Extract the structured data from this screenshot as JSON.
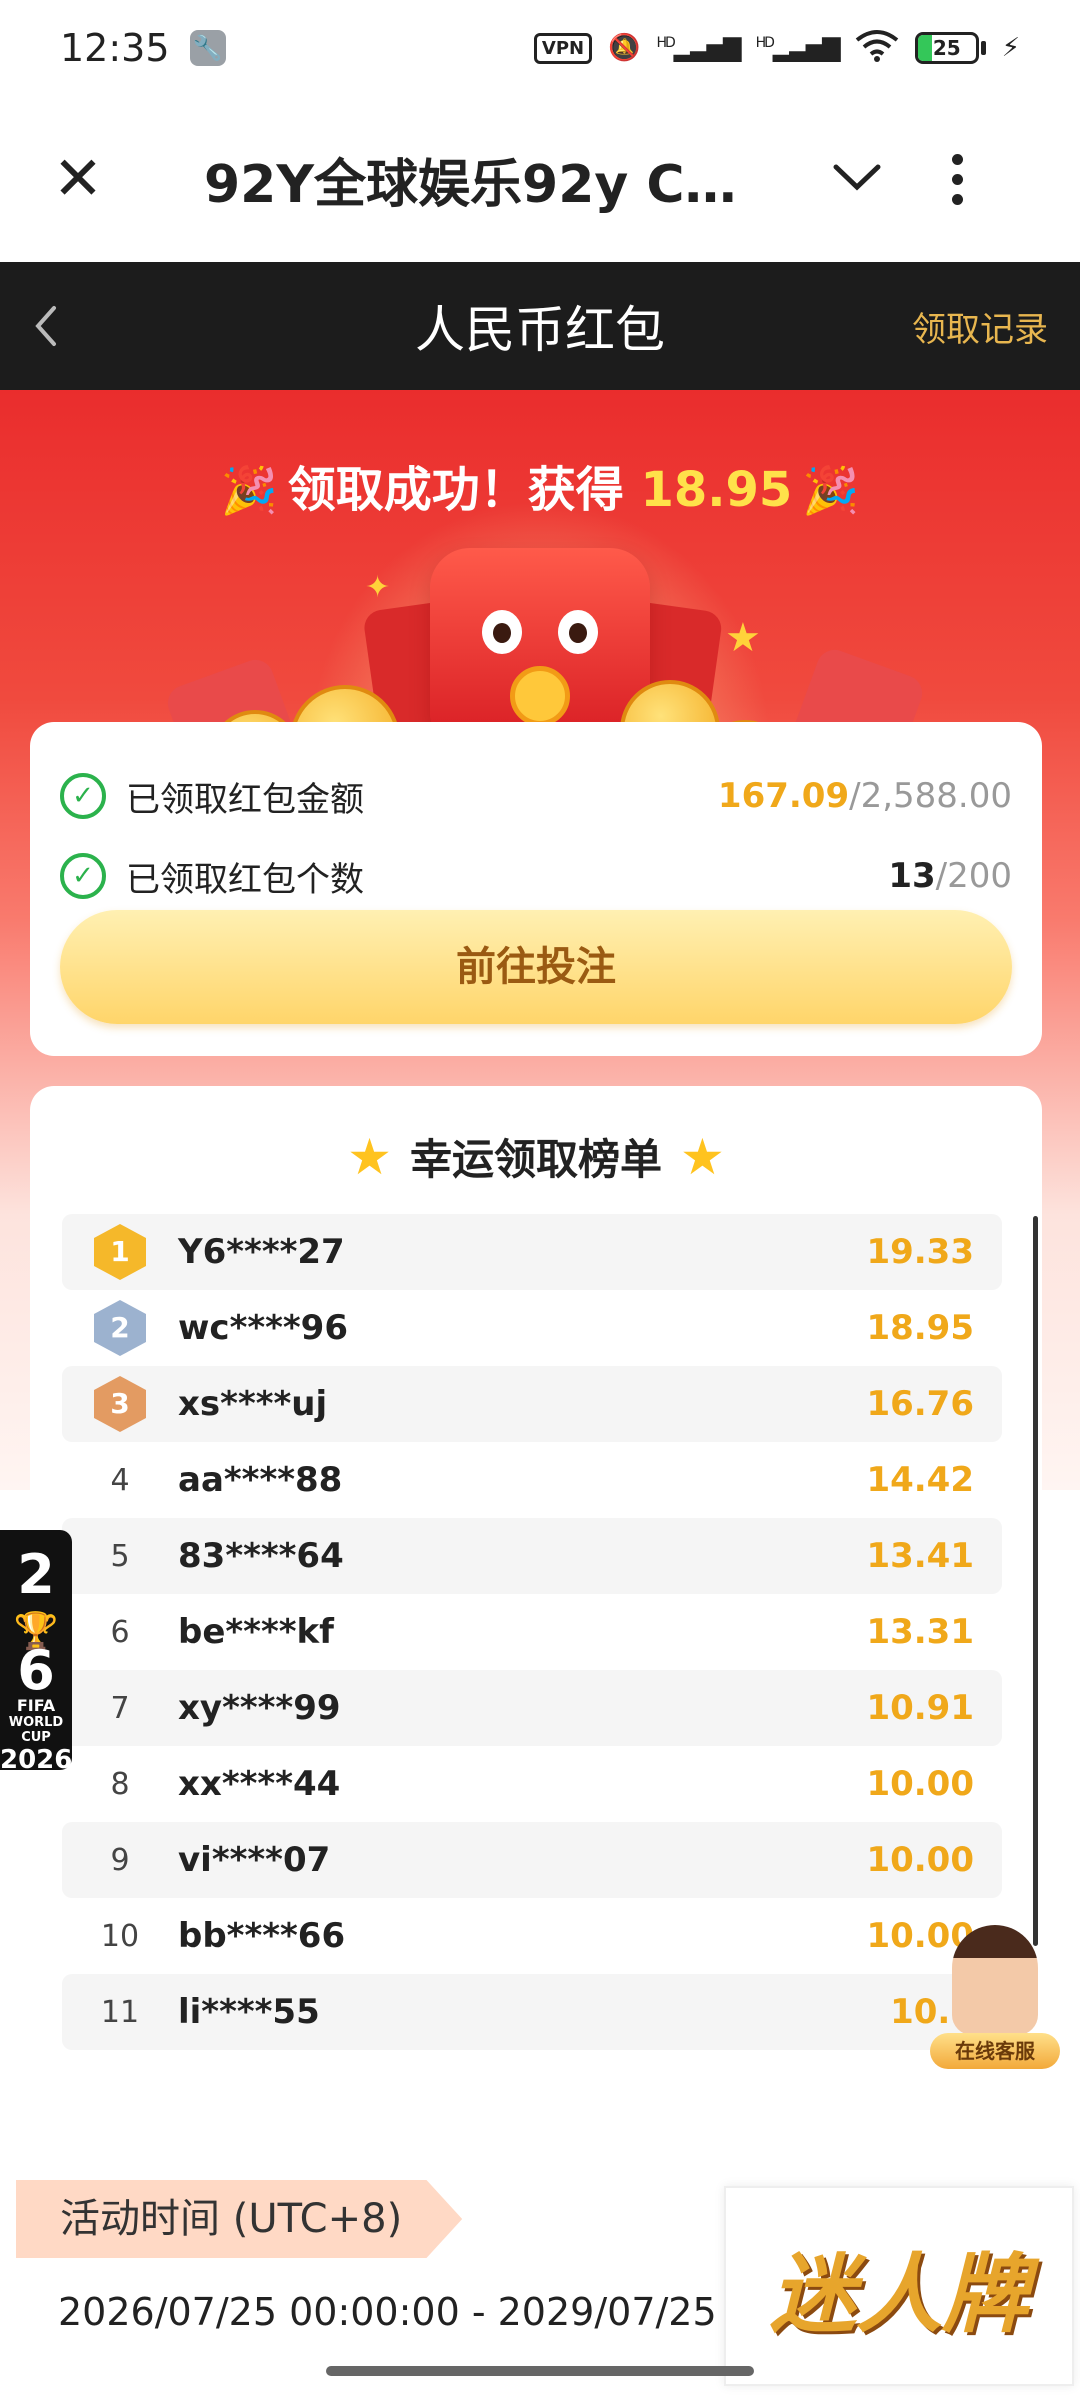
{
  "status_bar": {
    "time": "12:35",
    "vpn": "VPN",
    "signal1": "HD",
    "signal2": "HD",
    "battery": "25",
    "battery_level": 0.25
  },
  "browser": {
    "title": "92Y全球娱乐92y Ca..."
  },
  "header": {
    "title": "人民币红包",
    "records_link": "领取记录"
  },
  "success": {
    "prefix": "领取成功！获得",
    "amount": "18.95"
  },
  "stats": {
    "amount_label": "已领取红包金额",
    "amount_value": "167.09",
    "amount_total": "/2,588.00",
    "count_label": "已领取红包个数",
    "count_value": "13",
    "count_total": "/200",
    "cta": "前往投注"
  },
  "leaderboard": {
    "title": "幸运领取榜单",
    "rows": [
      {
        "rank": "1",
        "user": "Y6****27",
        "amount": "19.33"
      },
      {
        "rank": "2",
        "user": "wc****96",
        "amount": "18.95"
      },
      {
        "rank": "3",
        "user": "xs****uj",
        "amount": "16.76"
      },
      {
        "rank": "4",
        "user": "aa****88",
        "amount": "14.42"
      },
      {
        "rank": "5",
        "user": "83****64",
        "amount": "13.41"
      },
      {
        "rank": "6",
        "user": "be****kf",
        "amount": "13.31"
      },
      {
        "rank": "7",
        "user": "xy****99",
        "amount": "10.91"
      },
      {
        "rank": "8",
        "user": "xx****44",
        "amount": "10.00"
      },
      {
        "rank": "9",
        "user": "vi****07",
        "amount": "10.00"
      },
      {
        "rank": "10",
        "user": "bb****66",
        "amount": "10.00"
      },
      {
        "rank": "11",
        "user": "li****55",
        "amount": "10.0"
      }
    ]
  },
  "activity": {
    "tag": "活动时间 (UTC+8)",
    "time_range": "2026/07/25 00:00:00 - 2029/07/25"
  },
  "fifa_badge": {
    "year_top": "2",
    "year_bottom": "6",
    "line1": "FIFA",
    "line2": "WORLD CUP",
    "line3": "2026"
  },
  "service": {
    "label": "在线客服"
  },
  "brand": {
    "text": "迷人牌"
  },
  "colors": {
    "header_bg": "#1c1c1c",
    "accent_gold": "#f0a81a",
    "hero_red": "#ea2d2d",
    "check_green": "#2bb24c"
  }
}
